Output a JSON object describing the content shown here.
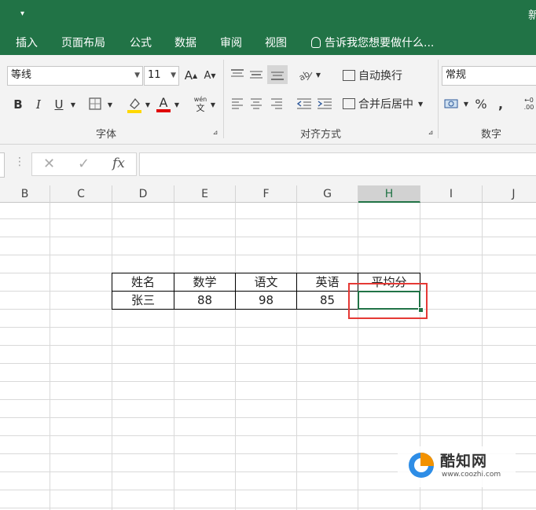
{
  "ribbon_tabs": [
    "插入",
    "页面布局",
    "公式",
    "数据",
    "审阅",
    "视图"
  ],
  "tell_me": "告诉我您想要做什么...",
  "font": {
    "name": "等线",
    "size": "11"
  },
  "group_labels": {
    "font": "字体",
    "alignment": "对齐方式",
    "number": "数字"
  },
  "alignment": {
    "wrap_text": "自动换行",
    "merge_center": "合并后居中"
  },
  "number_format": "常规",
  "formula_bar": {
    "cancel": "✕",
    "enter": "✓",
    "fx": "fx"
  },
  "columns": [
    "B",
    "C",
    "D",
    "E",
    "F",
    "G",
    "H",
    "I",
    "J"
  ],
  "table": {
    "headers": [
      "姓名",
      "数学",
      "语文",
      "英语",
      "平均分"
    ],
    "row": [
      "张三",
      "88",
      "98",
      "85",
      ""
    ]
  },
  "watermark": {
    "brand": "酷知网",
    "url": "www.coozhi.com"
  },
  "colors": {
    "excel_green": "#217346",
    "selection": "#217346",
    "highlight_box": "#e53935"
  }
}
